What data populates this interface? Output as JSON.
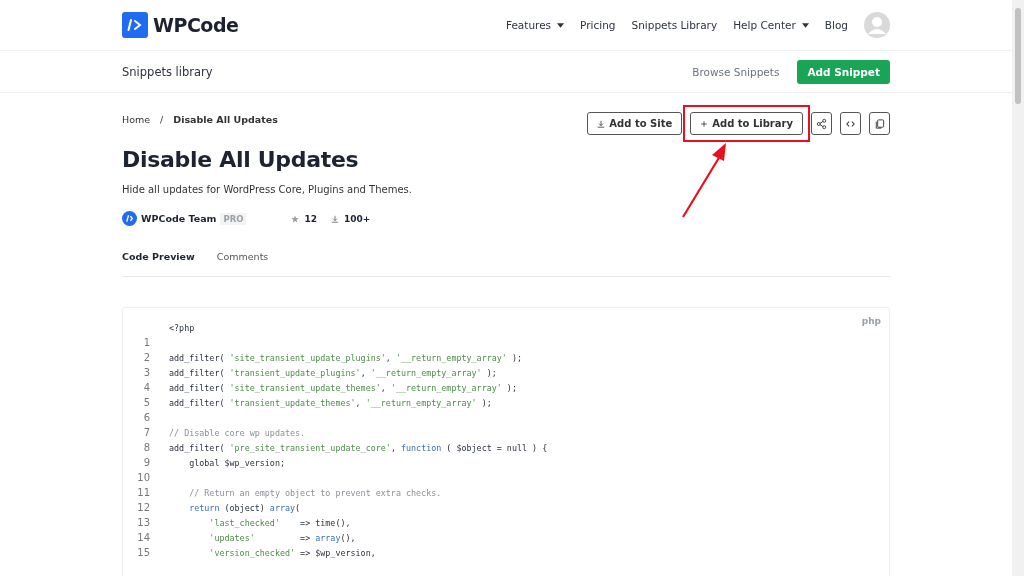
{
  "header": {
    "logo_text": "WPCode",
    "nav": [
      {
        "label": "Features",
        "dropdown": true
      },
      {
        "label": "Pricing",
        "dropdown": false
      },
      {
        "label": "Snippets Library",
        "dropdown": false
      },
      {
        "label": "Help Center",
        "dropdown": true
      },
      {
        "label": "Blog",
        "dropdown": false
      }
    ]
  },
  "subheader": {
    "title": "Snippets library",
    "link": "Browse Snippets",
    "button": "Add Snippet"
  },
  "breadcrumb": [
    "Home",
    "/",
    "Disable All Updates"
  ],
  "actions": [
    {
      "kind": "download",
      "label": "Add to Site",
      "highlighted": false
    },
    {
      "kind": "plus",
      "label": "Add to Library",
      "highlighted": true
    },
    {
      "kind": "share"
    },
    {
      "kind": "code"
    },
    {
      "kind": "copy"
    }
  ],
  "snippet": {
    "title": "Disable All Updates",
    "description": "Hide all updates for WordPress Core, Plugins and Themes.",
    "author": "WPCode Team",
    "badge": "PRO",
    "stars": "12",
    "installs": "100+"
  },
  "tabs": [
    {
      "label": "Code Preview",
      "selected": true
    },
    {
      "label": "Comments",
      "selected": false
    }
  ],
  "code": {
    "language": "php",
    "lines": [
      {
        "tokens": [
          {
            "kind": "plain",
            "text": "<?php"
          }
        ]
      },
      {
        "number": "1"
      },
      {
        "number": "2",
        "tokens": [
          {
            "kind": "plain",
            "text": "add_filter( "
          },
          {
            "kind": "string",
            "text": "'site_transient_update_plugins'"
          },
          {
            "kind": "plain",
            "text": ", "
          },
          {
            "kind": "string",
            "text": "'__return_empty_array'"
          },
          {
            "kind": "plain",
            "text": " );"
          }
        ]
      },
      {
        "number": "3",
        "tokens": [
          {
            "kind": "plain",
            "text": "add_filter( "
          },
          {
            "kind": "string",
            "text": "'transient_update_plugins'"
          },
          {
            "kind": "plain",
            "text": ", "
          },
          {
            "kind": "string",
            "text": "'__return_empty_array'"
          },
          {
            "kind": "plain",
            "text": " );"
          }
        ]
      },
      {
        "number": "4",
        "tokens": [
          {
            "kind": "plain",
            "text": "add_filter( "
          },
          {
            "kind": "string",
            "text": "'site_transient_update_themes'"
          },
          {
            "kind": "plain",
            "text": ", "
          },
          {
            "kind": "string",
            "text": "'__return_empty_array'"
          },
          {
            "kind": "plain",
            "text": " );"
          }
        ]
      },
      {
        "number": "5",
        "tokens": [
          {
            "kind": "plain",
            "text": "add_filter( "
          },
          {
            "kind": "string",
            "text": "'transient_update_themes'"
          },
          {
            "kind": "plain",
            "text": ", "
          },
          {
            "kind": "string",
            "text": "'__return_empty_array'"
          },
          {
            "kind": "plain",
            "text": " );"
          }
        ]
      },
      {
        "number": "6"
      },
      {
        "number": "7",
        "tokens": [
          {
            "kind": "comment",
            "text": "// Disable core wp updates."
          }
        ]
      },
      {
        "number": "8",
        "tokens": [
          {
            "kind": "plain",
            "text": "add_filter( "
          },
          {
            "kind": "string",
            "text": "'pre_site_transient_update_core'"
          },
          {
            "kind": "plain",
            "text": ", "
          },
          {
            "kind": "keyword",
            "text": "function"
          },
          {
            "kind": "plain",
            "text": " ( $object = null ) {"
          }
        ]
      },
      {
        "number": "9",
        "tokens": [
          {
            "kind": "plain",
            "text": "    global $wp_version;"
          }
        ]
      },
      {
        "number": "10"
      },
      {
        "number": "11",
        "tokens": [
          {
            "kind": "comment",
            "text": "    // Return an empty object to prevent extra checks."
          }
        ]
      },
      {
        "number": "12",
        "tokens": [
          {
            "kind": "keyword",
            "text": "    return"
          },
          {
            "kind": "plain",
            "text": " (object) "
          },
          {
            "kind": "keyword",
            "text": "array"
          },
          {
            "kind": "plain",
            "text": "("
          }
        ]
      },
      {
        "number": "13",
        "tokens": [
          {
            "kind": "string",
            "text": "        'last_checked'"
          },
          {
            "kind": "plain",
            "text": "    => time(),"
          }
        ]
      },
      {
        "number": "14",
        "tokens": [
          {
            "kind": "string",
            "text": "        'updates'"
          },
          {
            "kind": "plain",
            "text": "         => "
          },
          {
            "kind": "keyword",
            "text": "array"
          },
          {
            "kind": "plain",
            "text": "(),"
          }
        ]
      },
      {
        "number": "15",
        "tokens": [
          {
            "kind": "string",
            "text": "        'version_checked'"
          },
          {
            "kind": "plain",
            "text": " => $wp_version,"
          }
        ]
      }
    ]
  }
}
